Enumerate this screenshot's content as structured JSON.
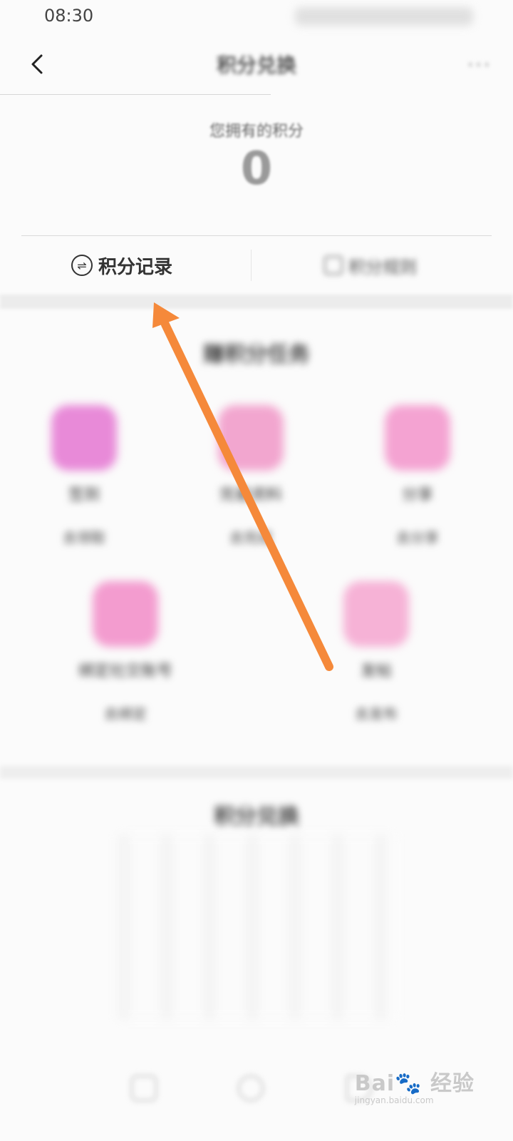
{
  "status_bar": {
    "time": "08:30"
  },
  "header": {
    "back_icon": "chevron-left-icon",
    "title": "积分兑换",
    "more_icon": "more-dots-icon",
    "more_text": "···"
  },
  "summary": {
    "label": "您拥有的积分",
    "points": "0"
  },
  "tabs": [
    {
      "label": "积分记录",
      "icon": "exchange-icon",
      "icon_glyph": "⇌"
    },
    {
      "label": "积分规则",
      "icon": "document-icon"
    }
  ],
  "earn": {
    "title": "赚积分任务",
    "tasks": [
      {
        "name": "签到",
        "reward": "去领取",
        "icon": "gift-icon",
        "color": "#e88ad8"
      },
      {
        "name": "完善资料",
        "reward": "去完成",
        "icon": "edit-icon",
        "color": "#f2a6cf"
      },
      {
        "name": "分享",
        "reward": "去分享",
        "icon": "file-icon",
        "color": "#f4a3d2"
      },
      {
        "name": "绑定社交账号",
        "reward": "去绑定",
        "icon": "checklist-icon",
        "color": "#f39ccf"
      },
      {
        "name": "发帖",
        "reward": "去发布",
        "icon": "compose-icon",
        "color": "#f6b2d6"
      }
    ]
  },
  "mall": {
    "title": "积分兑换"
  },
  "watermark": {
    "brand": "Bai🐾 经验",
    "url": "jingyan.baidu.com"
  },
  "colors": {
    "arrow": "#f5893a",
    "background": "#fbfbfb"
  }
}
